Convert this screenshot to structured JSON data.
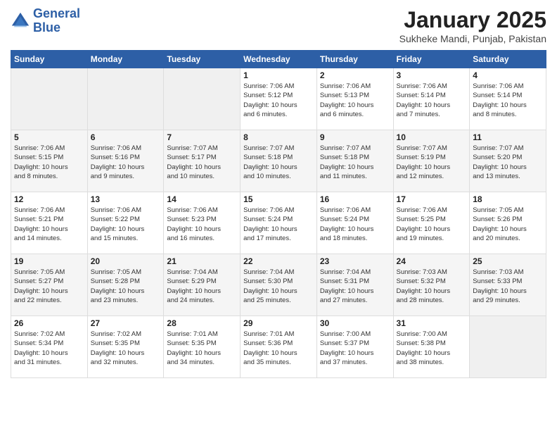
{
  "header": {
    "logo_line1": "General",
    "logo_line2": "Blue",
    "title": "January 2025",
    "subtitle": "Sukheke Mandi, Punjab, Pakistan"
  },
  "weekdays": [
    "Sunday",
    "Monday",
    "Tuesday",
    "Wednesday",
    "Thursday",
    "Friday",
    "Saturday"
  ],
  "weeks": [
    [
      {
        "day": "",
        "info": ""
      },
      {
        "day": "",
        "info": ""
      },
      {
        "day": "",
        "info": ""
      },
      {
        "day": "1",
        "info": "Sunrise: 7:06 AM\nSunset: 5:12 PM\nDaylight: 10 hours\nand 6 minutes."
      },
      {
        "day": "2",
        "info": "Sunrise: 7:06 AM\nSunset: 5:13 PM\nDaylight: 10 hours\nand 6 minutes."
      },
      {
        "day": "3",
        "info": "Sunrise: 7:06 AM\nSunset: 5:14 PM\nDaylight: 10 hours\nand 7 minutes."
      },
      {
        "day": "4",
        "info": "Sunrise: 7:06 AM\nSunset: 5:14 PM\nDaylight: 10 hours\nand 8 minutes."
      }
    ],
    [
      {
        "day": "5",
        "info": "Sunrise: 7:06 AM\nSunset: 5:15 PM\nDaylight: 10 hours\nand 8 minutes."
      },
      {
        "day": "6",
        "info": "Sunrise: 7:06 AM\nSunset: 5:16 PM\nDaylight: 10 hours\nand 9 minutes."
      },
      {
        "day": "7",
        "info": "Sunrise: 7:07 AM\nSunset: 5:17 PM\nDaylight: 10 hours\nand 10 minutes."
      },
      {
        "day": "8",
        "info": "Sunrise: 7:07 AM\nSunset: 5:18 PM\nDaylight: 10 hours\nand 10 minutes."
      },
      {
        "day": "9",
        "info": "Sunrise: 7:07 AM\nSunset: 5:18 PM\nDaylight: 10 hours\nand 11 minutes."
      },
      {
        "day": "10",
        "info": "Sunrise: 7:07 AM\nSunset: 5:19 PM\nDaylight: 10 hours\nand 12 minutes."
      },
      {
        "day": "11",
        "info": "Sunrise: 7:07 AM\nSunset: 5:20 PM\nDaylight: 10 hours\nand 13 minutes."
      }
    ],
    [
      {
        "day": "12",
        "info": "Sunrise: 7:06 AM\nSunset: 5:21 PM\nDaylight: 10 hours\nand 14 minutes."
      },
      {
        "day": "13",
        "info": "Sunrise: 7:06 AM\nSunset: 5:22 PM\nDaylight: 10 hours\nand 15 minutes."
      },
      {
        "day": "14",
        "info": "Sunrise: 7:06 AM\nSunset: 5:23 PM\nDaylight: 10 hours\nand 16 minutes."
      },
      {
        "day": "15",
        "info": "Sunrise: 7:06 AM\nSunset: 5:24 PM\nDaylight: 10 hours\nand 17 minutes."
      },
      {
        "day": "16",
        "info": "Sunrise: 7:06 AM\nSunset: 5:24 PM\nDaylight: 10 hours\nand 18 minutes."
      },
      {
        "day": "17",
        "info": "Sunrise: 7:06 AM\nSunset: 5:25 PM\nDaylight: 10 hours\nand 19 minutes."
      },
      {
        "day": "18",
        "info": "Sunrise: 7:05 AM\nSunset: 5:26 PM\nDaylight: 10 hours\nand 20 minutes."
      }
    ],
    [
      {
        "day": "19",
        "info": "Sunrise: 7:05 AM\nSunset: 5:27 PM\nDaylight: 10 hours\nand 22 minutes."
      },
      {
        "day": "20",
        "info": "Sunrise: 7:05 AM\nSunset: 5:28 PM\nDaylight: 10 hours\nand 23 minutes."
      },
      {
        "day": "21",
        "info": "Sunrise: 7:04 AM\nSunset: 5:29 PM\nDaylight: 10 hours\nand 24 minutes."
      },
      {
        "day": "22",
        "info": "Sunrise: 7:04 AM\nSunset: 5:30 PM\nDaylight: 10 hours\nand 25 minutes."
      },
      {
        "day": "23",
        "info": "Sunrise: 7:04 AM\nSunset: 5:31 PM\nDaylight: 10 hours\nand 27 minutes."
      },
      {
        "day": "24",
        "info": "Sunrise: 7:03 AM\nSunset: 5:32 PM\nDaylight: 10 hours\nand 28 minutes."
      },
      {
        "day": "25",
        "info": "Sunrise: 7:03 AM\nSunset: 5:33 PM\nDaylight: 10 hours\nand 29 minutes."
      }
    ],
    [
      {
        "day": "26",
        "info": "Sunrise: 7:02 AM\nSunset: 5:34 PM\nDaylight: 10 hours\nand 31 minutes."
      },
      {
        "day": "27",
        "info": "Sunrise: 7:02 AM\nSunset: 5:35 PM\nDaylight: 10 hours\nand 32 minutes."
      },
      {
        "day": "28",
        "info": "Sunrise: 7:01 AM\nSunset: 5:35 PM\nDaylight: 10 hours\nand 34 minutes."
      },
      {
        "day": "29",
        "info": "Sunrise: 7:01 AM\nSunset: 5:36 PM\nDaylight: 10 hours\nand 35 minutes."
      },
      {
        "day": "30",
        "info": "Sunrise: 7:00 AM\nSunset: 5:37 PM\nDaylight: 10 hours\nand 37 minutes."
      },
      {
        "day": "31",
        "info": "Sunrise: 7:00 AM\nSunset: 5:38 PM\nDaylight: 10 hours\nand 38 minutes."
      },
      {
        "day": "",
        "info": ""
      }
    ]
  ]
}
